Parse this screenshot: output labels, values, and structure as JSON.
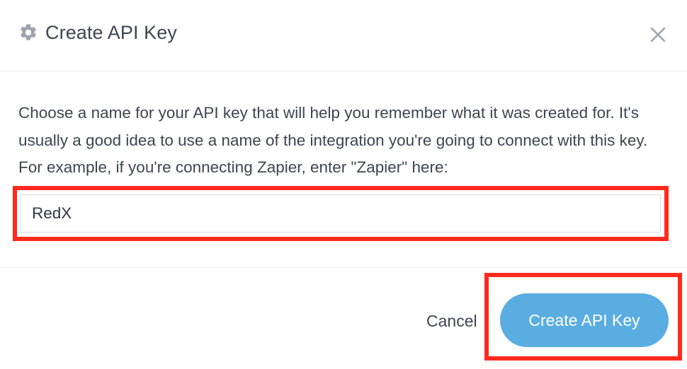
{
  "dialog": {
    "title": "Create API Key",
    "header_icon": "gear-icon",
    "close_icon": "close-icon"
  },
  "description": "Choose a name for your API key that will help you remember what it was created for. It's usually a good idea to use a name of the integration you're going to connect with this key. For example, if you're connecting Zapier, enter \"Zapier\" here:",
  "name_input": {
    "value": "RedX",
    "placeholder": ""
  },
  "footer": {
    "cancel_label": "Cancel",
    "create_label": "Create API Key"
  },
  "colors": {
    "primary_button": "#5aade0",
    "highlight": "#ff2a1f",
    "text": "#3d4552",
    "icon": "#9aa3ae"
  }
}
